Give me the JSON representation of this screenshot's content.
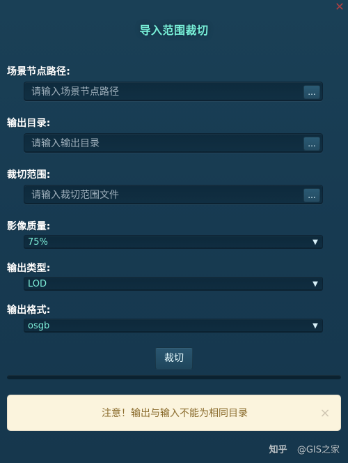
{
  "dialog": {
    "title": "导入范围裁切",
    "close_icon": "close-icon"
  },
  "form": {
    "scene_node_path": {
      "label": "场景节点路径:",
      "value": "",
      "placeholder": "请输入场景节点路径",
      "browse_label": "..."
    },
    "output_dir": {
      "label": "输出目录:",
      "value": "",
      "placeholder": "请输入输出目录",
      "browse_label": "..."
    },
    "crop_range": {
      "label": "裁切范围:",
      "value": "",
      "placeholder": "请输入裁切范围文件",
      "browse_label": "..."
    },
    "image_quality": {
      "label": "影像质量:",
      "selected": "75%",
      "caret": "▼"
    },
    "output_type": {
      "label": "输出类型:",
      "selected": "LOD",
      "caret": "▼"
    },
    "output_format": {
      "label": "输出格式:",
      "selected": "osgb",
      "caret": "▼"
    },
    "crop_button_label": "裁切",
    "progress": 0
  },
  "alert": {
    "message": "注意！输出与输入不能为相同目录",
    "close": "×"
  },
  "watermark": {
    "platform": "知乎",
    "author": "@GIS之家"
  },
  "colors": {
    "background": "#173a51",
    "title": "#78f0d9",
    "select_value": "#7ff0da",
    "alert_bg": "#fbf4dd",
    "alert_text": "#8a6b2c",
    "close_red": "#c13f3f"
  }
}
